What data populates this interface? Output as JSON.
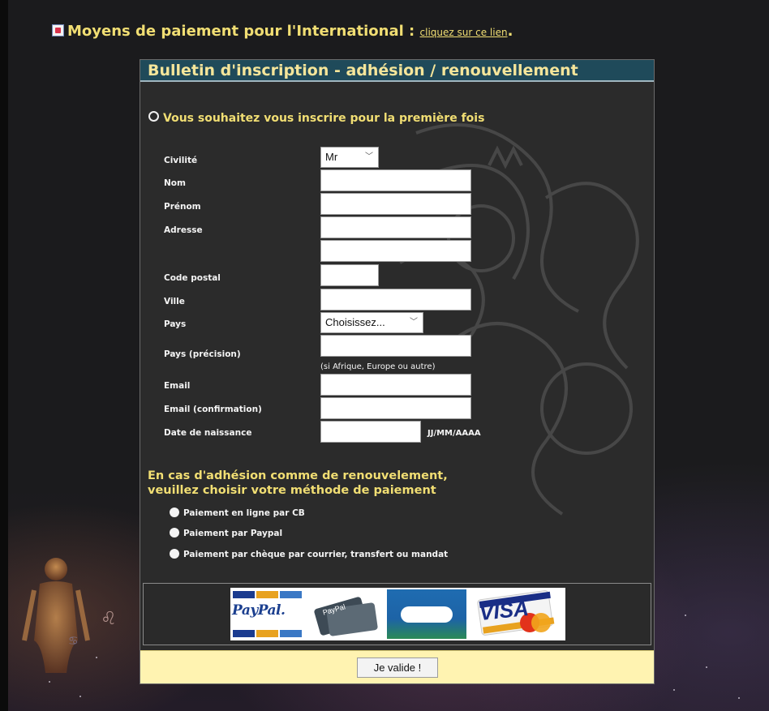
{
  "intl": {
    "icon": "flag-icon",
    "label": "Moyens de paiement pour l'International :",
    "link_text": "cliquez sur ce lien",
    "period": "."
  },
  "form": {
    "title": "Bulletin d'inscription - adhésion / renouvellement",
    "first_time_label": "Vous souhaitez vous inscrire pour la première fois",
    "fields": {
      "civilite": {
        "label": "Civilité",
        "value": "Mr",
        "options_visible": [
          "Mr"
        ]
      },
      "nom": {
        "label": "Nom",
        "value": ""
      },
      "prenom": {
        "label": "Prénom",
        "value": ""
      },
      "adresse": {
        "label": "Adresse",
        "value_line1": "",
        "value_line2": ""
      },
      "code_postal": {
        "label": "Code postal",
        "value": ""
      },
      "ville": {
        "label": "Ville",
        "value": ""
      },
      "pays": {
        "label": "Pays",
        "value": "Choisissez..."
      },
      "pays_precision": {
        "label": "Pays (précision)",
        "value": "",
        "hint": "(si Afrique, Europe ou autre)"
      },
      "email": {
        "label": "Email",
        "value": ""
      },
      "email_confirmation": {
        "label": "Email (confirmation)",
        "value": ""
      },
      "date_naissance": {
        "label": "Date de naissance",
        "value": "",
        "hint": "JJ/MM/AAAA"
      }
    },
    "payment": {
      "title_line1": "En cas d'adhésion comme de renouvelement,",
      "title_line2": "veuillez choisir votre méthode de paiement",
      "options": [
        "Paiement en ligne par CB",
        "Paiement par Paypal",
        "Paiement par chèque par courrier, transfert ou mandat"
      ]
    },
    "logos": [
      "paypal-logo",
      "credit-cards-logo",
      "cb-logo",
      "visa-logo"
    ],
    "submit_label": "Je valide !"
  },
  "colors": {
    "accent_yellow": "#f1de73",
    "header_teal": "#1f4a5a",
    "submit_bar": "#fff3b1"
  }
}
